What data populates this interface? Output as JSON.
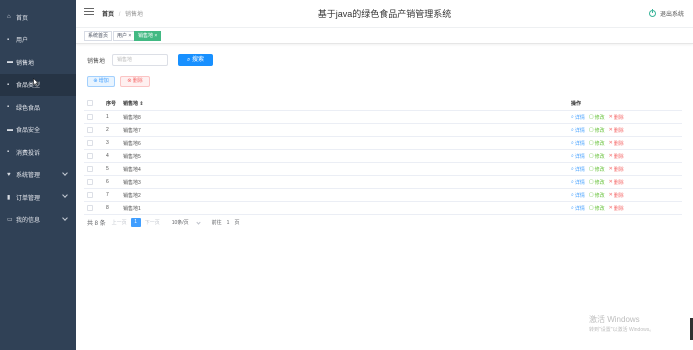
{
  "sidebar": {
    "items": [
      {
        "icon": "⌂",
        "label": "首页",
        "expandable": false,
        "active": false
      },
      {
        "icon": "▪",
        "label": "用户",
        "expandable": false,
        "active": false
      },
      {
        "icon": "▬",
        "label": "销售地",
        "expandable": false,
        "active": false
      },
      {
        "icon": "▪",
        "label": "食品类型",
        "expandable": false,
        "active": true
      },
      {
        "icon": "▪",
        "label": "绿色食品",
        "expandable": false,
        "active": false
      },
      {
        "icon": "▬",
        "label": "食品安全",
        "expandable": false,
        "active": false
      },
      {
        "icon": "▪",
        "label": "消费投诉",
        "expandable": false,
        "active": false
      },
      {
        "icon": "♥",
        "label": "系统管理",
        "expandable": true,
        "active": false
      },
      {
        "icon": "▮",
        "label": "订单管理",
        "expandable": true,
        "active": false
      },
      {
        "icon": "▭",
        "label": "我的信息",
        "expandable": true,
        "active": false
      }
    ]
  },
  "header": {
    "breadcrumb_home": "首页",
    "breadcrumb_current": "销售地",
    "title": "基于java的绿色食品产销管理系统",
    "logout_label": "退出系统"
  },
  "tags": [
    {
      "label": "系统首页",
      "active": false,
      "closable": false
    },
    {
      "label": "用户 ×",
      "active": false,
      "closable": true
    },
    {
      "label": "销售地 ×",
      "active": true,
      "closable": true
    }
  ],
  "search": {
    "label": "销售地",
    "placeholder": "销售地",
    "button_label": "搜索"
  },
  "actions": {
    "add_label": "增加",
    "delete_label": "删除"
  },
  "table": {
    "columns": {
      "index": "序号",
      "name": "销售地 ⇕",
      "ops": "操作"
    },
    "rows": [
      {
        "index": "1",
        "name": "销售地8"
      },
      {
        "index": "2",
        "name": "销售地7"
      },
      {
        "index": "3",
        "name": "销售地6"
      },
      {
        "index": "4",
        "name": "销售地5"
      },
      {
        "index": "5",
        "name": "销售地4"
      },
      {
        "index": "6",
        "name": "销售地3"
      },
      {
        "index": "7",
        "name": "销售地2"
      },
      {
        "index": "8",
        "name": "销售地1"
      }
    ],
    "op_labels": {
      "view": "详情",
      "edit": "修改",
      "delete": "删除"
    }
  },
  "pagination": {
    "total": "共 8 条",
    "prev": "上一页",
    "current_page": "1",
    "next": "下一页",
    "page_size": "10条/页",
    "goto": "前往",
    "goto_value": "1",
    "unit": "页"
  },
  "watermark": {
    "line1": "激活 Windows",
    "line2": "转到\"设置\"以激活 Windows。"
  },
  "colors": {
    "sidebar_bg": "#304156",
    "primary": "#1890ff",
    "active_tag": "#42b983",
    "danger": "#f56c6c",
    "success": "#67c23a"
  }
}
